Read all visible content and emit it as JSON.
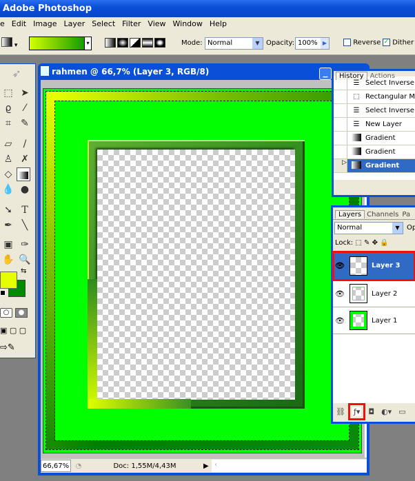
{
  "app": {
    "title": "Adobe Photoshop"
  },
  "menu": [
    "e",
    "Edit",
    "Image",
    "Layer",
    "Select",
    "Filter",
    "View",
    "Window",
    "Help"
  ],
  "options": {
    "mode_label": "Mode:",
    "mode_value": "Normal",
    "opacity_label": "Opacity:",
    "opacity_value": "100%",
    "reverse_label": "Reverse",
    "reverse_checked": false,
    "dither_label": "Dither",
    "dither_checked": true,
    "gradient_colors": [
      "#d4ff00",
      "#009000"
    ]
  },
  "toolbox": {
    "foreground_color": "#e5ff00",
    "background_color": "#008a00"
  },
  "document": {
    "title": "rahmen @ 66,7% (Layer 3, RGB/8)",
    "zoom": "66,67%",
    "doc_info": "Doc: 1,55M/4,43M"
  },
  "history": {
    "tabs": [
      "History",
      "Actions"
    ],
    "items": [
      {
        "label": "Select Inverse",
        "icon": "step-icon"
      },
      {
        "label": "Rectangular M",
        "icon": "marquee-icon"
      },
      {
        "label": "Select Inverse",
        "icon": "step-icon"
      },
      {
        "label": "New Layer",
        "icon": "step-icon"
      },
      {
        "label": "Gradient",
        "icon": "gradient-icon"
      },
      {
        "label": "Gradient",
        "icon": "gradient-icon"
      },
      {
        "label": "Gradient",
        "icon": "gradient-icon",
        "selected": true
      }
    ]
  },
  "layers": {
    "tabs": [
      "Layers",
      "Channels",
      "Pa"
    ],
    "blend_mode": "Normal",
    "opacity_label": "Op",
    "lock_label": "Lock:",
    "items": [
      {
        "name": "Layer 3",
        "selected": true,
        "visible": true
      },
      {
        "name": "Layer 2",
        "visible": true
      },
      {
        "name": "Layer 1",
        "visible": true
      }
    ]
  }
}
